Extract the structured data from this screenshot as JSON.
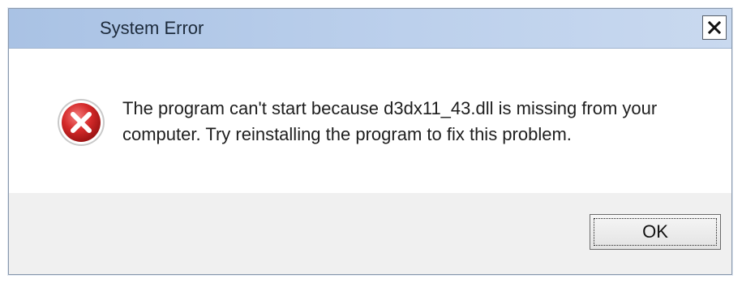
{
  "dialog": {
    "title": "System Error",
    "close_label": "×",
    "message": "The program can't start because d3dx11_43.dll  is missing from your computer. Try reinstalling the program to fix this problem.",
    "icon": "error-icon",
    "ok_label": "OK"
  },
  "colors": {
    "titlebar": "#bcd0ec",
    "icon_red": "#d42a2a",
    "content_bg": "#ffffff",
    "footer_bg": "#f0f0f0"
  }
}
